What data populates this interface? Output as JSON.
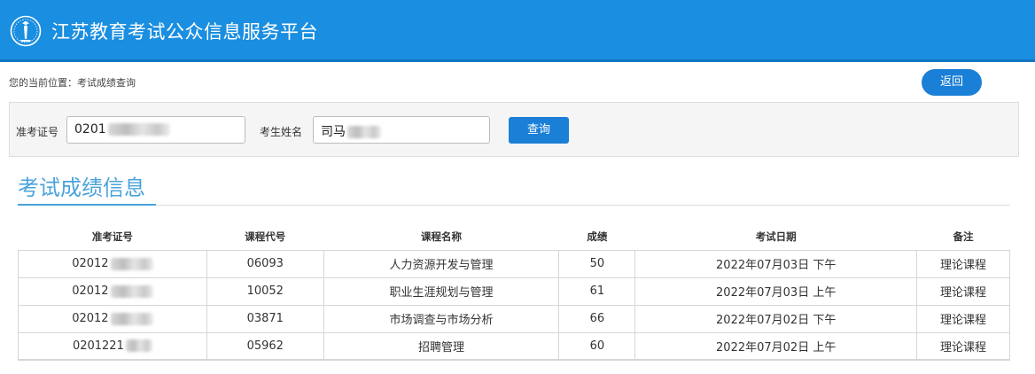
{
  "header": {
    "title": "江苏教育考试公众信息服务平台",
    "bg_color": "#1a8ee0"
  },
  "breadcrumb": {
    "prefix": "您的当前位置：",
    "current": "考试成绩查询"
  },
  "back_button": {
    "label": "返回"
  },
  "search": {
    "ticket_label": "准考证号",
    "ticket_value": "0201",
    "name_label": "考生姓名",
    "name_value": "司马",
    "query_label": "查询"
  },
  "section": {
    "title": "考试成绩信息",
    "accent_color": "#4aa3dc"
  },
  "table": {
    "headers": [
      "准考证号",
      "课程代号",
      "课程名称",
      "成绩",
      "考试日期",
      "备注"
    ],
    "rows": [
      [
        "02012",
        "06093",
        "人力资源开发与管理",
        "50",
        "2022年07月03日 下午",
        "理论课程"
      ],
      [
        "02012",
        "10052",
        "职业生涯规划与管理",
        "61",
        "2022年07月03日 上午",
        "理论课程"
      ],
      [
        "02012",
        "03871",
        "市场调查与市场分析",
        "66",
        "2022年07月02日 下午",
        "理论课程"
      ],
      [
        "0201221",
        "05962",
        "招聘管理",
        "60",
        "2022年07月02日 上午",
        "理论课程"
      ]
    ]
  },
  "icons": {
    "logo": "torch-emblem-icon"
  },
  "colors": {
    "button_blue": "#1a7fd6"
  }
}
